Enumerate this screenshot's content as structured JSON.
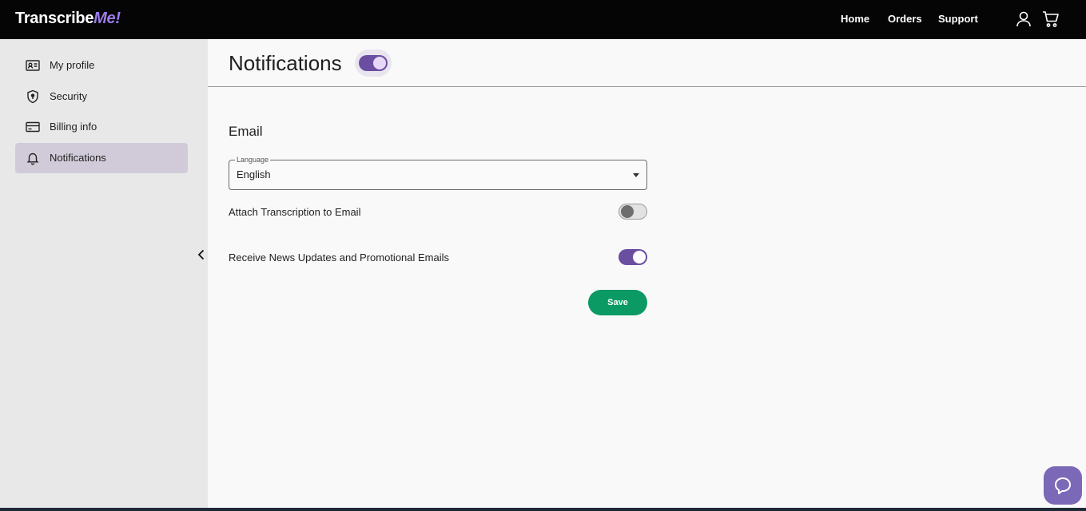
{
  "brand": {
    "name_part1": "Transcribe",
    "name_part2": "Me!"
  },
  "nav": {
    "home": "Home",
    "orders": "Orders",
    "support": "Support"
  },
  "sidebar": {
    "items": [
      {
        "label": "My profile",
        "icon": "id-card-icon"
      },
      {
        "label": "Security",
        "icon": "shield-icon"
      },
      {
        "label": "Billing info",
        "icon": "credit-card-icon"
      },
      {
        "label": "Notifications",
        "icon": "bell-icon",
        "active": true
      }
    ]
  },
  "page": {
    "title": "Notifications",
    "master_toggle_on": true
  },
  "email": {
    "section_title": "Email",
    "language": {
      "legend": "Language",
      "value": "English"
    },
    "attach_transcription": {
      "label": "Attach Transcription to Email",
      "on": false
    },
    "news_updates": {
      "label": "Receive News Updates and Promotional Emails",
      "on": true
    },
    "save_label": "Save"
  },
  "colors": {
    "accent": "#6a4fa0",
    "save": "#0b9a64",
    "topbar": "#050505",
    "brand_me": "#9b7bea"
  }
}
